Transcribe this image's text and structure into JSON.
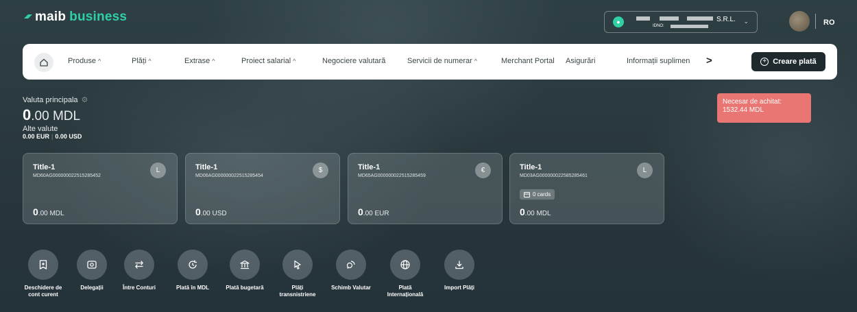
{
  "brand": {
    "name": "maib",
    "suffix": "business"
  },
  "company": {
    "name_suffix": "S.R.L.",
    "idno_label": "IDNO:"
  },
  "language": "RO",
  "nav": {
    "items": [
      {
        "label": "Produse",
        "caret": "^"
      },
      {
        "label": "Plăți",
        "caret": "^"
      },
      {
        "label": "Extrase",
        "caret": "^"
      },
      {
        "label": "Proiect salarial",
        "caret": "^"
      },
      {
        "label": "Negociere valutară",
        "caret": ""
      },
      {
        "label": "Servicii de numerar",
        "caret": "^"
      },
      {
        "label": "Merchant Portal",
        "caret": ""
      },
      {
        "label": "Asigurări",
        "caret": ""
      },
      {
        "label": "Informații suplimen",
        "caret": ""
      }
    ],
    "more": ">",
    "create_label": "Creare plată"
  },
  "balance": {
    "label": "Valuta principala",
    "main_int": "0",
    "main_dec": ".00 MDL",
    "other_label": "Alte valute",
    "eur": "0.00 EUR",
    "usd": "0.00 USD"
  },
  "due": {
    "label": "Necesar de achitat:",
    "amount": "1532.44 MDL"
  },
  "accounts": [
    {
      "title": "Title-1",
      "iban": "MD60AG000000022515285452",
      "cur_sym": "L",
      "int": "0",
      "dec": ".00 MDL",
      "cards": ""
    },
    {
      "title": "Title-1",
      "iban": "MD06AG000000022515285454",
      "cur_sym": "$",
      "int": "0",
      "dec": ".00 USD",
      "cards": ""
    },
    {
      "title": "Title-1",
      "iban": "MD65AG000000022515285459",
      "cur_sym": "€",
      "int": "0",
      "dec": ".00 EUR",
      "cards": ""
    },
    {
      "title": "Title-1",
      "iban": "MD03AG000000022585285461",
      "cur_sym": "L",
      "int": "0",
      "dec": ".00 MDL",
      "cards": "0 cards"
    }
  ],
  "actions": [
    {
      "label": "Deschidere de cont curent",
      "icon": "document-plus-icon"
    },
    {
      "label": "Delegații",
      "icon": "id-card-icon"
    },
    {
      "label": "Între Conturi",
      "icon": "transfer-arrows-icon"
    },
    {
      "label": "Plată în MDL",
      "icon": "clock-arrow-icon"
    },
    {
      "label": "Plată bugetară",
      "icon": "bank-icon"
    },
    {
      "label": "Plăți transnistriene",
      "icon": "pointer-icon"
    },
    {
      "label": "Schimb Valutar",
      "icon": "exchange-icon"
    },
    {
      "label": "Plată Internațională",
      "icon": "globe-icon"
    },
    {
      "label": "Import Plăți",
      "icon": "download-icon"
    }
  ]
}
